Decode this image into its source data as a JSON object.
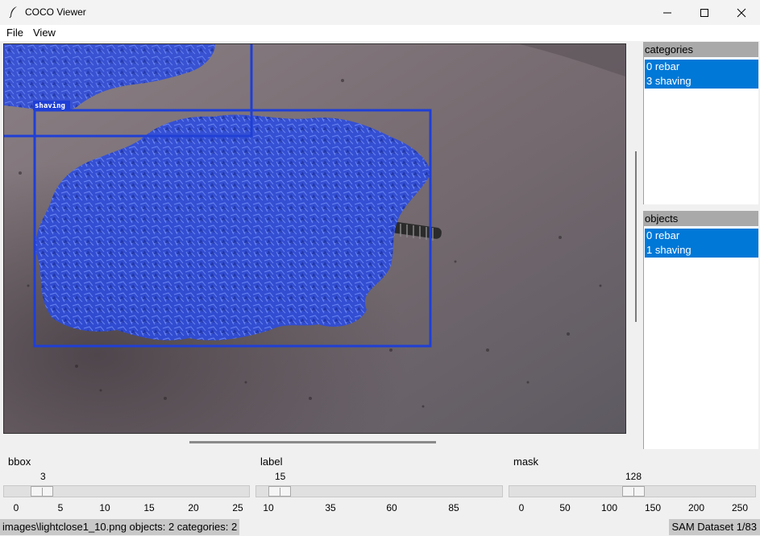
{
  "window": {
    "title": "COCO Viewer"
  },
  "menu": {
    "items": [
      "File",
      "View"
    ]
  },
  "image": {
    "annotation_label": "shaving"
  },
  "categories": {
    "header": "categories",
    "items": [
      "0 rebar",
      "3 shaving"
    ]
  },
  "objects": {
    "header": "objects",
    "items": [
      "0 rebar",
      "1 shaving"
    ]
  },
  "sliders": [
    {
      "name": "bbox",
      "value": "3",
      "ticks": [
        "0",
        "5",
        "10",
        "15",
        "20",
        "25"
      ]
    },
    {
      "name": "label",
      "value": "15",
      "ticks": [
        "10",
        "35",
        "60",
        "85"
      ]
    },
    {
      "name": "mask",
      "value": "128",
      "ticks": [
        "0",
        "50",
        "100",
        "150",
        "200",
        "250"
      ]
    }
  ],
  "status": {
    "left": "images\\lightclose1_10.png objects: 2 categories: 2",
    "right": "SAM Dataset 1/83"
  },
  "colors": {
    "selection": "#0078d7",
    "annotation": "#1f3fd6"
  }
}
